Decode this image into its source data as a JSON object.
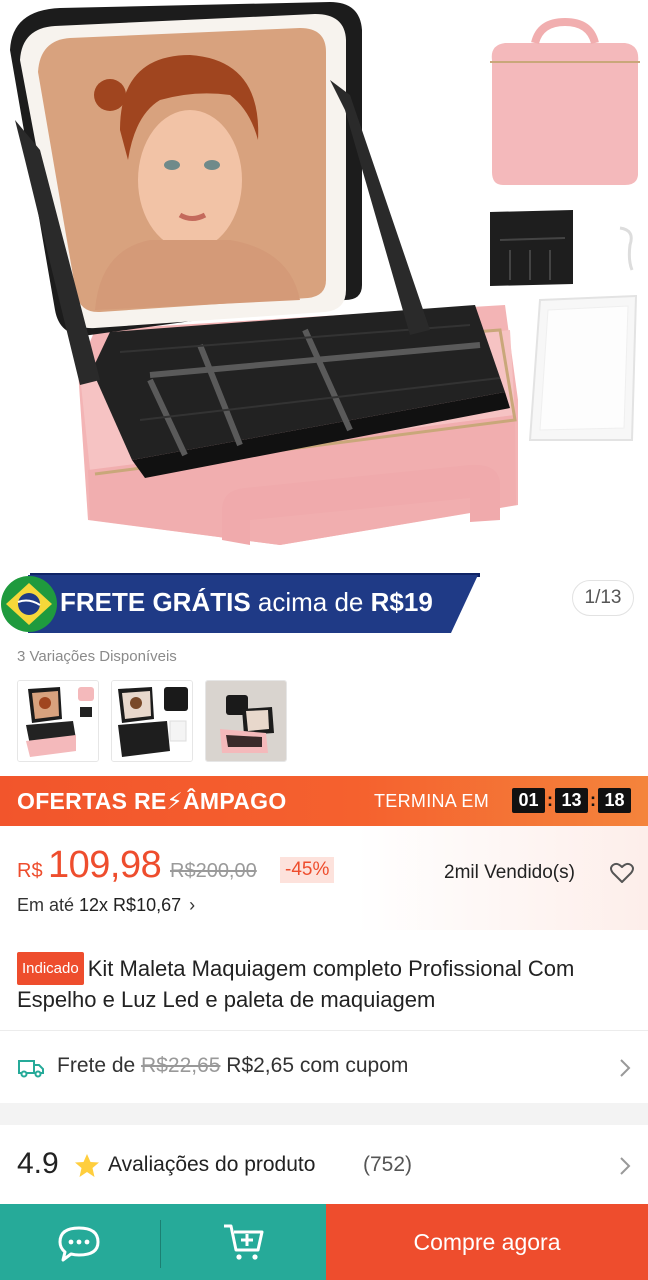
{
  "hero": {
    "page_counter": "1/13",
    "banner": {
      "bold": "FRETE GRÁTIS",
      "rest": " acima de ",
      "amount": "R$19"
    }
  },
  "variations": {
    "title": "3 Variações Disponíveis",
    "items": [
      "variation-pink",
      "variation-black-mirror",
      "variation-black-set"
    ]
  },
  "flash_sale": {
    "title": "OFERTAS RE⚡ÂMPAGO",
    "ends_label": "TERMINA EM",
    "timer": {
      "hours": "01",
      "minutes": "13",
      "seconds": "18"
    }
  },
  "price": {
    "currency": "R$",
    "value": "109,98",
    "old": "R$200,00",
    "discount": "-45%",
    "sold": "2mil Vendido(s)",
    "installment_prefix": "Em até ",
    "installment": "12x R$10,67",
    "chevron": "›"
  },
  "product": {
    "badge": "Indicado",
    "title": "Kit Maleta Maquiagem completo Profissional Com Espelho e Luz Led e paleta de maquiagem"
  },
  "shipping": {
    "prefix": "Frete de ",
    "old": "R$22,65",
    "new": " R$2,65 com cupom"
  },
  "rating": {
    "score": "4.9",
    "label": "Avaliações do produto",
    "count": "(752)"
  },
  "bottom_bar": {
    "buy_label": "Compre agora"
  },
  "colors": {
    "accent": "#ee4d2d",
    "teal": "#26aa99",
    "banner_blue": "#1f3a86",
    "case_pink": "#f4b9bb"
  }
}
